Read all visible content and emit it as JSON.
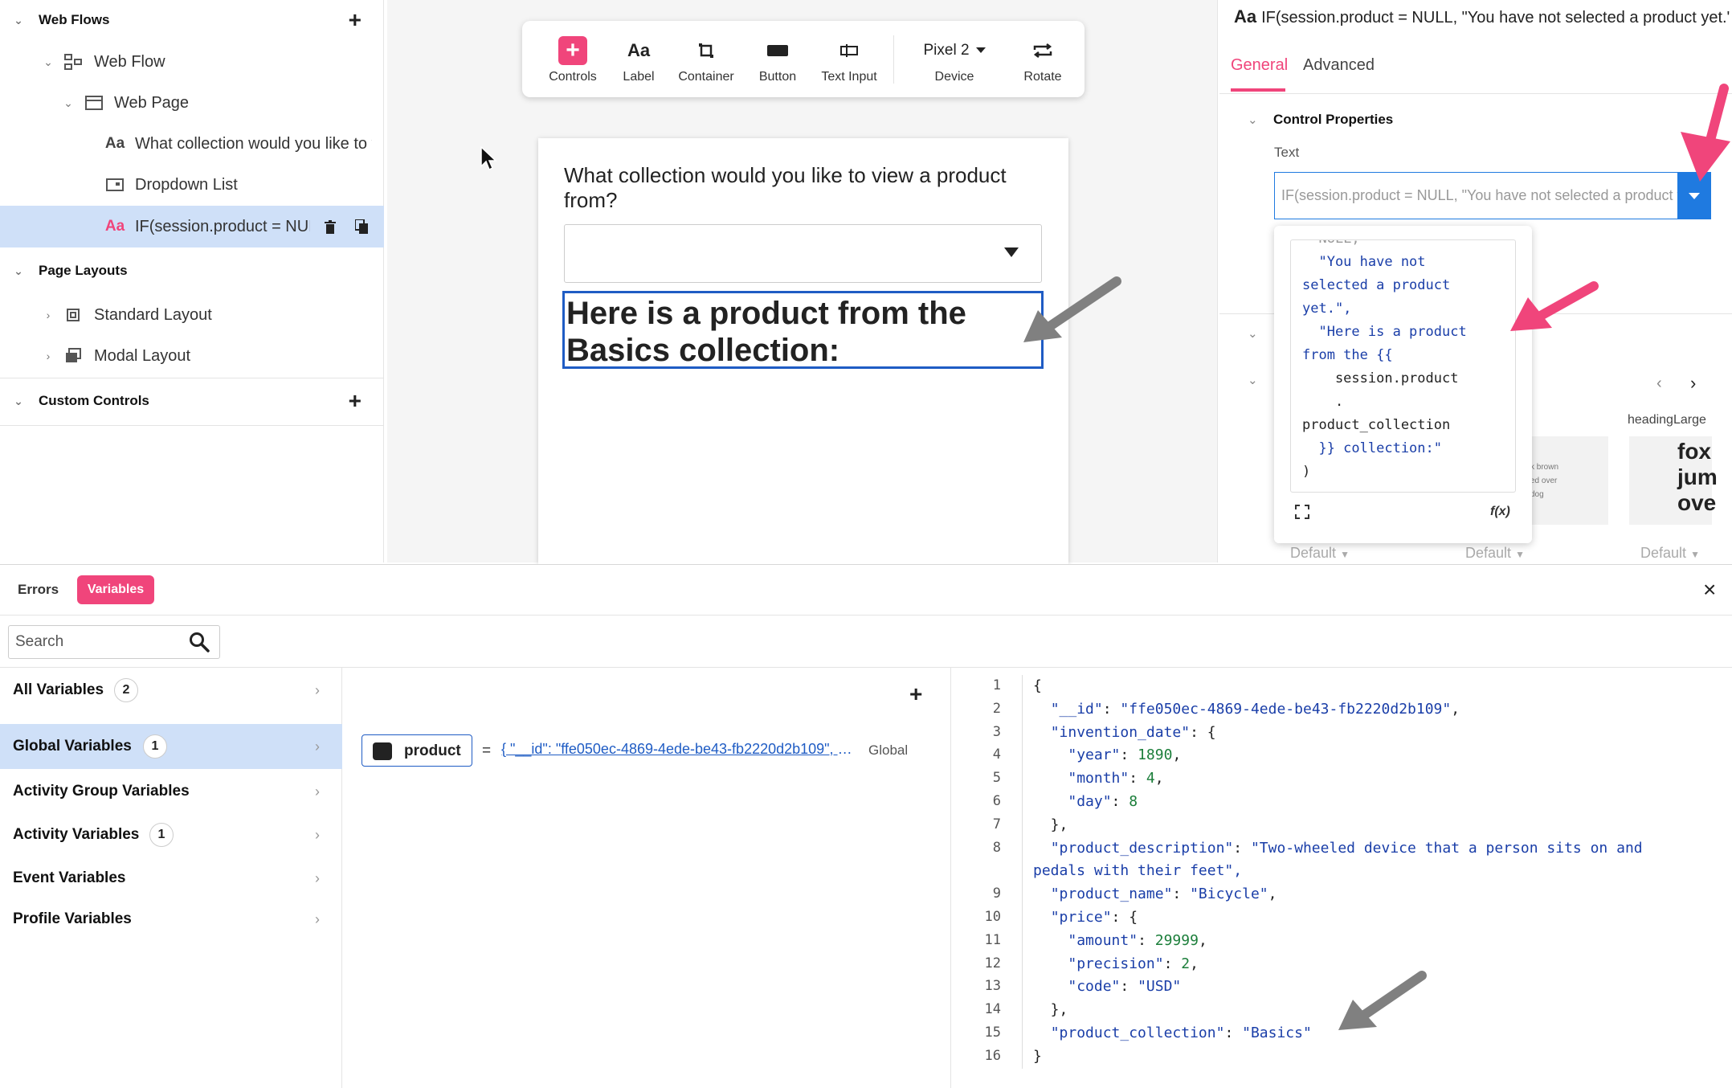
{
  "left_tree": {
    "web_flows": "Web Flows",
    "web_flow": "Web Flow",
    "web_page": "Web Page",
    "item_label": "What collection would you like to v",
    "item_dropdown": "Dropdown List",
    "item_selected": "IF(session.product = NUL",
    "page_layouts": "Page Layouts",
    "standard_layout": "Standard Layout",
    "modal_layout": "Modal Layout",
    "custom_controls": "Custom Controls"
  },
  "toolbar": {
    "controls": "Controls",
    "label": "Label",
    "label_icon": "Aa",
    "container": "Container",
    "button": "Button",
    "text_input": "Text Input",
    "device_value": "Pixel 2",
    "device": "Device",
    "rotate": "Rotate"
  },
  "canvas": {
    "question": "What collection would you like to view a product from?",
    "heading": "Here is a product from the Basics collection:"
  },
  "right_panel": {
    "title_icon": "Aa",
    "title": "IF(session.product = NULL, \"You have not selected a product yet.\",",
    "tabs": [
      "General",
      "Advanced"
    ],
    "section": "Control Properties",
    "text_label": "Text",
    "text_value": "IF(session.product = NULL, \"You have not selected a product yet.\",",
    "style_name": "headingLarge",
    "style_preview": [
      "fox",
      "jum",
      "ove"
    ],
    "style_snippet": [
      "k brown",
      "ed over",
      "dog"
    ],
    "defaults": [
      "Default",
      "Default",
      "Default"
    ],
    "expression_lines": [
      "  NULL,",
      "  \"You have not",
      "selected a product",
      "yet.\",",
      "  \"Here is a product",
      "from the {{",
      "    session.product",
      "    .",
      "product_collection",
      "  }} collection:\"",
      ")"
    ],
    "fx_label": "f(x)"
  },
  "bottom": {
    "tabs": {
      "errors": "Errors",
      "variables": "Variables"
    },
    "search_placeholder": "Search",
    "nav": [
      {
        "label": "All Variables",
        "count": "2"
      },
      {
        "label": "Global Variables",
        "count": "1"
      },
      {
        "label": "Activity Group Variables",
        "count": ""
      },
      {
        "label": "Activity Variables",
        "count": "1"
      },
      {
        "label": "Event Variables",
        "count": ""
      },
      {
        "label": "Profile Variables",
        "count": ""
      }
    ],
    "variable": {
      "name": "product",
      "eq": "=",
      "value": "{ \"__id\": \"ffe050ec-4869-4ede-be43-fb2220d2b109\", \"invention_date\": ...",
      "scope": "Global"
    },
    "json_lines": [
      "{",
      "  \"__id\": \"ffe050ec-4869-4ede-be43-fb2220d2b109\",",
      "  \"invention_date\": {",
      "    \"year\": 1890,",
      "    \"month\": 4,",
      "    \"day\": 8",
      "  },",
      "  \"product_description\": \"Two-wheeled device that a person sits on and",
      "pedals with their feet\",",
      "  \"product_name\": \"Bicycle\",",
      "  \"price\": {",
      "    \"amount\": 29999,",
      "    \"precision\": 2,",
      "    \"code\": \"USD\"",
      "  },",
      "  \"product_collection\": \"Basics\"",
      "}"
    ],
    "line_numbers": [
      "1",
      "2",
      "3",
      "4",
      "5",
      "6",
      "7",
      "8",
      "",
      "9",
      "10",
      "11",
      "12",
      "13",
      "14",
      "15",
      "16"
    ]
  },
  "colors": {
    "accent": "#f0457b",
    "selection": "#cfe0f8",
    "link": "#1f5cc4",
    "annotation_arrow_pink": "#f0457b",
    "annotation_arrow_gray": "#808080"
  }
}
